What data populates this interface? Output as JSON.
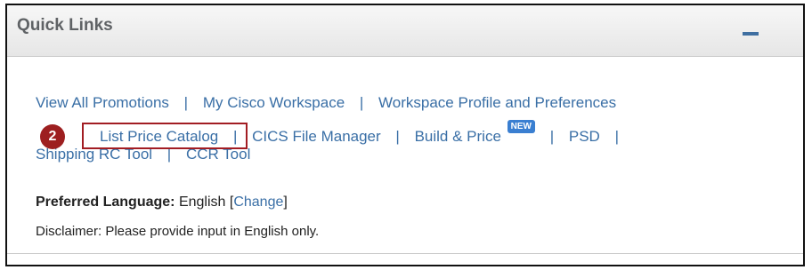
{
  "panel": {
    "title": "Quick Links",
    "collapse_icon": "minus-icon"
  },
  "links": {
    "row1": [
      "View All Promotions",
      "My Cisco Workspace",
      "Workspace Profile and Preferences"
    ],
    "row2": [
      "List Price Catalog",
      "CICS File Manager",
      "Build & Price",
      "PSD"
    ],
    "row3": [
      "Shipping RC Tool",
      "CCR Tool"
    ],
    "separator": "|",
    "new_badge": "NEW"
  },
  "annotation": {
    "step_number": "2",
    "color": "#9d1f20"
  },
  "preferences": {
    "label": "Preferred Language:",
    "value": "English",
    "change_link": "Change",
    "open_bracket": "[",
    "close_bracket": "]"
  },
  "disclaimer": "Disclaimer: Please provide input in English only.",
  "colors": {
    "link": "#3a6fa6",
    "title": "#5f6265",
    "accent": "#3f6fa1"
  }
}
